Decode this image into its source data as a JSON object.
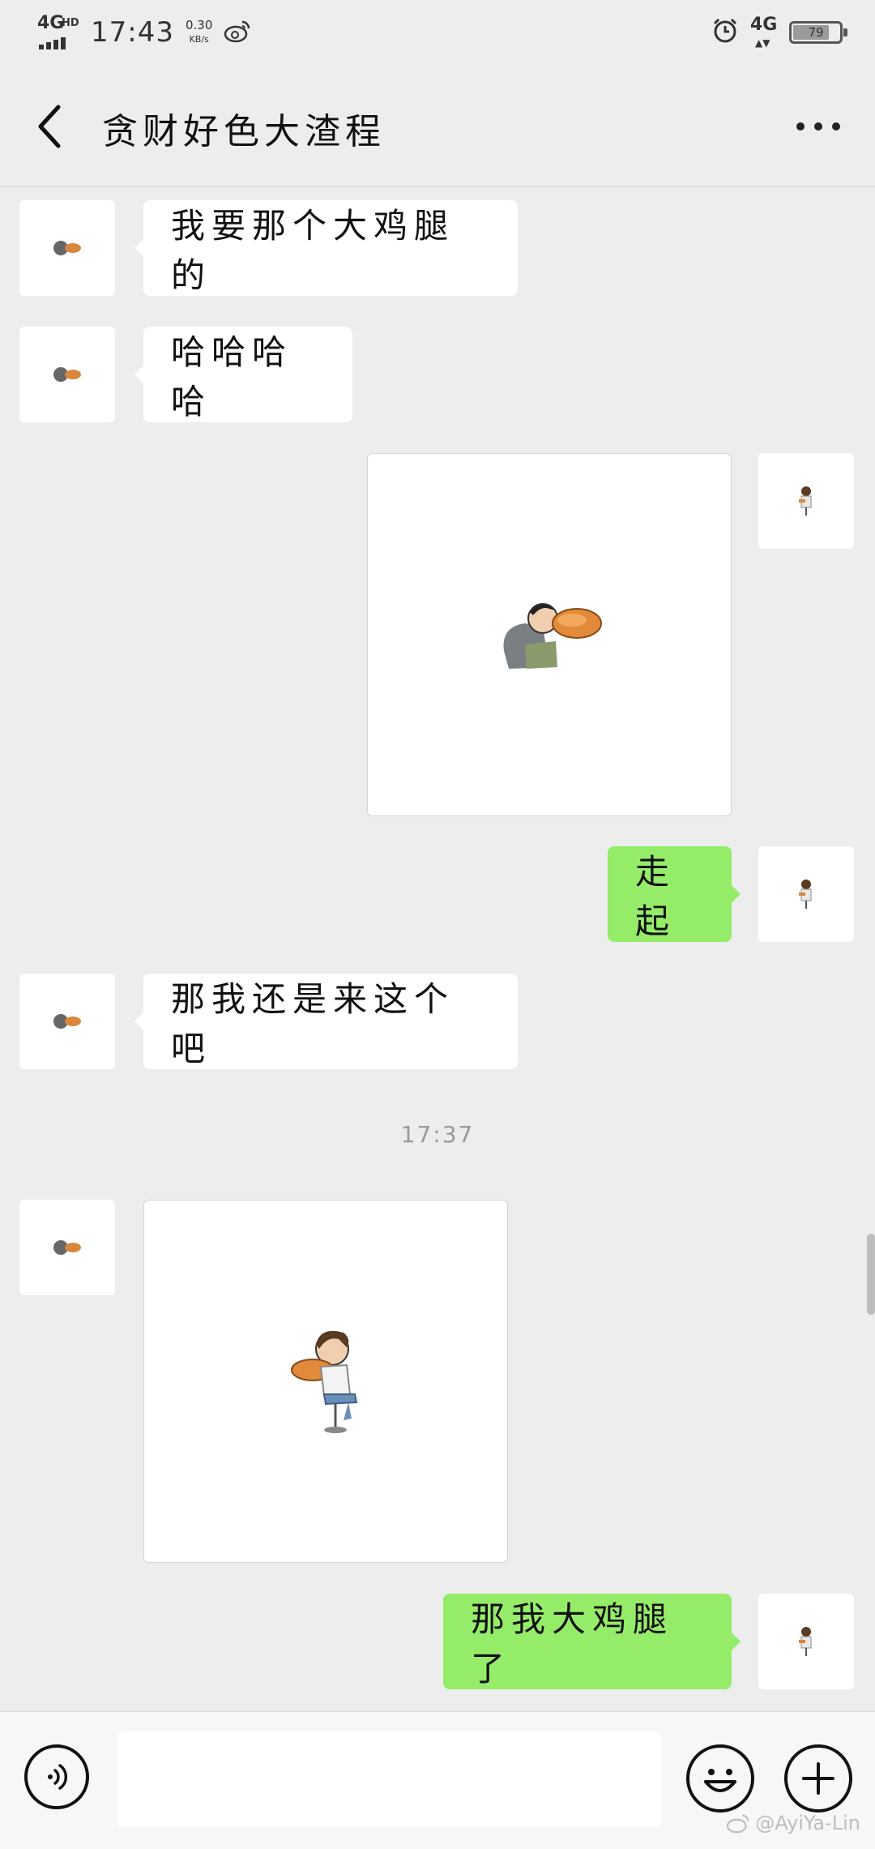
{
  "status_bar": {
    "network": "4G",
    "network_sup": "HD",
    "time": "17:43",
    "speed_value": "0.30",
    "speed_unit": "KB/s",
    "network_right": "4G",
    "battery": "79",
    "battery_level": 0.79
  },
  "header": {
    "title": "贪财好色大渣程"
  },
  "messages": [
    {
      "side": "in",
      "text": "我要那个大鸡腿的"
    },
    {
      "side": "in",
      "text": "哈哈哈哈"
    },
    {
      "side": "out",
      "image": "sticker-man-eating-drumstick"
    },
    {
      "side": "out",
      "text": "走起"
    },
    {
      "side": "in",
      "text": "那我还是来这个吧"
    },
    {
      "time": "17:37"
    },
    {
      "side": "in",
      "image": "sticker-man-sitting-eating-drumstick"
    },
    {
      "side": "out",
      "text": "那我大鸡腿了"
    }
  ],
  "input": {
    "placeholder": ""
  },
  "watermark": "@AyiYa-Lin",
  "colors": {
    "background": "#ededed",
    "incoming_bubble": "#ffffff",
    "outgoing_bubble": "#95ec69"
  }
}
